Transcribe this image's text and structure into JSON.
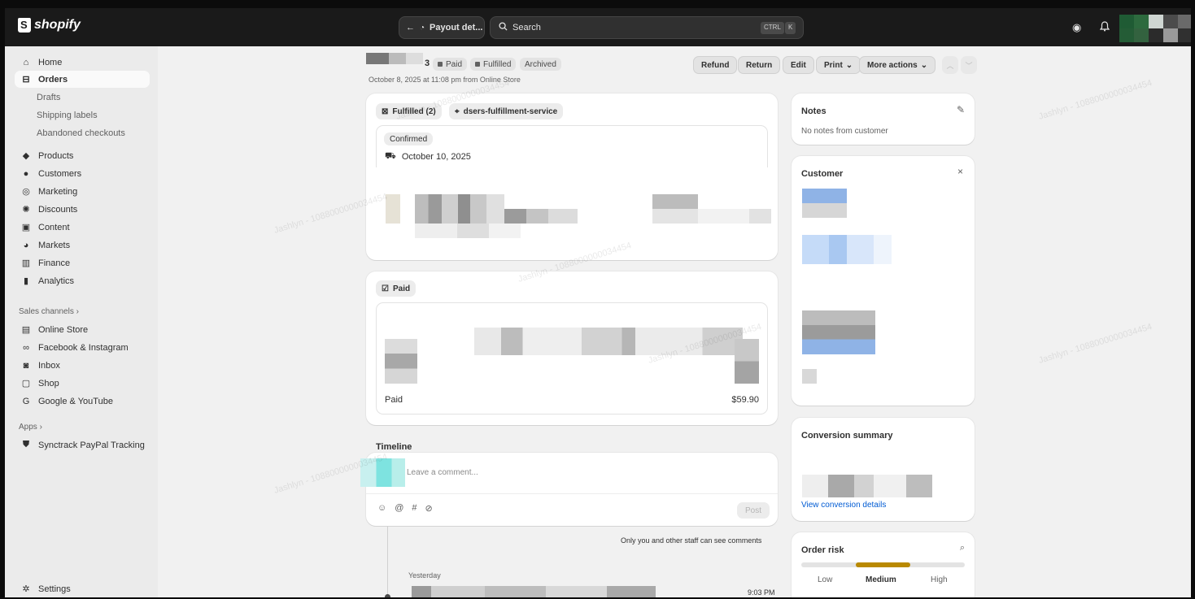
{
  "topbar": {
    "brand": "shopify",
    "back_label": "Payout det...",
    "search_placeholder": "Search",
    "shortcut_ctrl": "CTRL",
    "shortcut_k": "K"
  },
  "sidebar": {
    "items": [
      {
        "label": "Home",
        "icon": "home-icon"
      },
      {
        "label": "Orders",
        "icon": "orders-icon",
        "active": true
      },
      {
        "label": "Drafts"
      },
      {
        "label": "Shipping labels"
      },
      {
        "label": "Abandoned checkouts"
      },
      {
        "label": "Products",
        "icon": "tag-icon"
      },
      {
        "label": "Customers",
        "icon": "person-icon"
      },
      {
        "label": "Marketing",
        "icon": "target-icon"
      },
      {
        "label": "Discounts",
        "icon": "discount-icon"
      },
      {
        "label": "Content",
        "icon": "content-icon"
      },
      {
        "label": "Markets",
        "icon": "globe-icon"
      },
      {
        "label": "Finance",
        "icon": "bank-icon"
      },
      {
        "label": "Analytics",
        "icon": "bar-chart-icon"
      }
    ],
    "sales_channels_label": "Sales channels",
    "channels": [
      {
        "label": "Online Store",
        "icon": "store-icon"
      },
      {
        "label": "Facebook & Instagram",
        "icon": "meta-icon"
      },
      {
        "label": "Inbox",
        "icon": "inbox-icon"
      },
      {
        "label": "Shop",
        "icon": "shop-icon"
      },
      {
        "label": "Google & YouTube",
        "icon": "google-icon"
      }
    ],
    "apps_label": "Apps",
    "apps": [
      {
        "label": "Synctrack PayPal Tracking",
        "icon": "shield-icon"
      }
    ],
    "settings_label": "Settings"
  },
  "order": {
    "number_suffix": "3",
    "badges": {
      "paid": "Paid",
      "fulfilled": "Fulfilled",
      "archived": "Archived"
    },
    "subtitle": "October 8, 2025 at 11:08 pm from Online Store",
    "actions": {
      "refund": "Refund",
      "return": "Return",
      "edit": "Edit",
      "print": "Print",
      "more": "More actions"
    }
  },
  "fulfillment": {
    "status_chip": "Fulfilled (2)",
    "location_chip": "dsers-fulfillment-service",
    "confirmed": "Confirmed",
    "date": "October 10, 2025"
  },
  "payment": {
    "chip": "Paid",
    "paid_label": "Paid",
    "paid_amount": "$59.90"
  },
  "timeline": {
    "title": "Timeline",
    "comment_placeholder": "Leave a comment...",
    "post_label": "Post",
    "staff_note": "Only you and other staff can see comments",
    "day_label": "Yesterday",
    "event_time": "9:03 PM"
  },
  "notes": {
    "title": "Notes",
    "empty": "No notes from customer"
  },
  "customer": {
    "title": "Customer"
  },
  "conversion": {
    "title": "Conversion summary",
    "link": "View conversion details"
  },
  "risk": {
    "title": "Order risk",
    "level": "Medium",
    "low": "Low",
    "medium": "Medium",
    "high": "High",
    "accent": "#b98900"
  },
  "watermark": "Jashlyn - 1088000000034454"
}
